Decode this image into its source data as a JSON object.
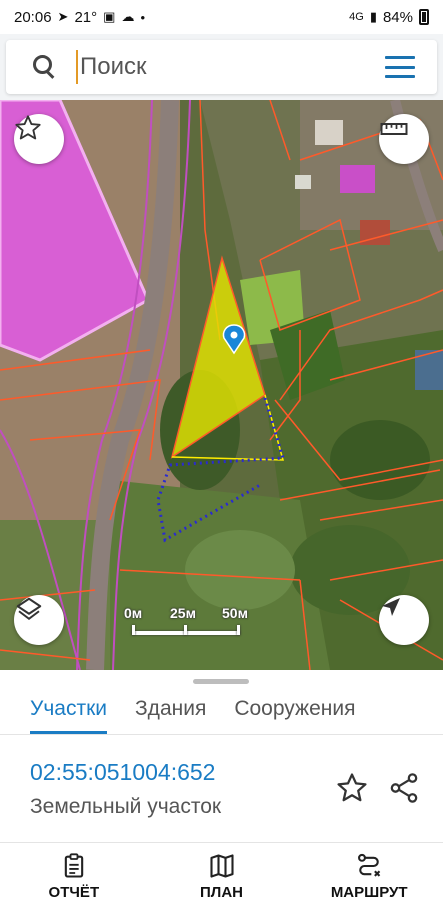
{
  "status_bar": {
    "time": "20:06",
    "temperature": "21°",
    "network": "4G",
    "battery": "84%"
  },
  "search": {
    "placeholder": "Поиск"
  },
  "map": {
    "scale_labels": [
      "0м",
      "25м",
      "50м"
    ]
  },
  "sheet": {
    "tabs": [
      {
        "label": "Участки",
        "active": true
      },
      {
        "label": "Здания",
        "active": false
      },
      {
        "label": "Сооружения",
        "active": false
      }
    ],
    "parcel": {
      "cadastral_number": "02:55:051004:652",
      "type": "Земельный участок"
    }
  },
  "bottom_nav": {
    "items": [
      {
        "label": "ОТЧЁТ",
        "icon": "report-icon"
      },
      {
        "label": "ПЛАН",
        "icon": "map-plan-icon"
      },
      {
        "label": "МАРШРУТ",
        "icon": "route-icon"
      }
    ]
  },
  "colors": {
    "accent": "#1a7cc4",
    "parcel_fill": "#e6e600",
    "parcel_border": "#ff5a2a"
  }
}
